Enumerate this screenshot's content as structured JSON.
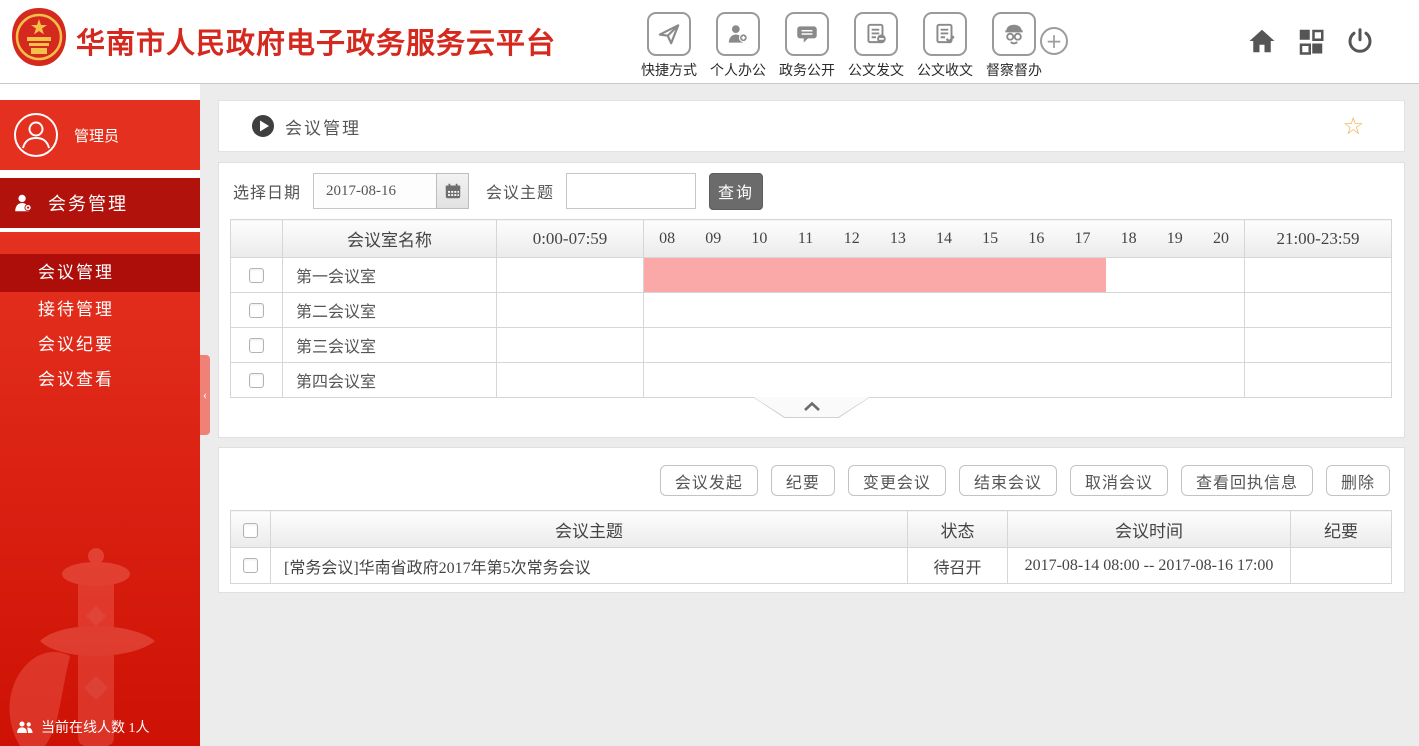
{
  "app": {
    "title": "华南市人民政府电子政务服务云平台"
  },
  "topbar": {
    "quick_items": [
      {
        "label": "快捷方式"
      },
      {
        "label": "个人办公"
      },
      {
        "label": "政务公开"
      },
      {
        "label": "公文发文"
      },
      {
        "label": "公文收文"
      },
      {
        "label": "督察督办"
      }
    ],
    "add_glyph": "+"
  },
  "sidebar": {
    "user_name": "管理员",
    "section_label": "会务管理",
    "menu": [
      {
        "label": "会议管理"
      },
      {
        "label": "接待管理"
      },
      {
        "label": "会议纪要"
      },
      {
        "label": "会议查看"
      }
    ],
    "collapse_glyph": "‹",
    "online_label": "当前在线人数 1人"
  },
  "page": {
    "title": "会议管理",
    "favorite_glyph": "☆"
  },
  "filter": {
    "date_label": "选择日期",
    "date_value": "2017-08-16",
    "topic_label": "会议主题",
    "topic_value": "",
    "search_button": "查询"
  },
  "schedule": {
    "room_header": "会议室名称",
    "early_header": "0:00-07:59",
    "hour_labels": [
      "08",
      "09",
      "10",
      "11",
      "12",
      "13",
      "14",
      "15",
      "16",
      "17",
      "18",
      "19",
      "20"
    ],
    "late_header": "21:00-23:59",
    "rows": [
      {
        "room": "第一会议室",
        "highlighted": true,
        "busy_range": "08:00-17:59"
      },
      {
        "room": "第二会议室"
      },
      {
        "room": "第三会议室"
      },
      {
        "room": "第四会议室"
      }
    ],
    "busy_color": "#fba8a8",
    "highlight_color": "#fdfbdc"
  },
  "actions": {
    "labels": [
      "会议发起",
      "纪要",
      "变更会议",
      "结束会议",
      "取消会议",
      "查看回执信息",
      "删除"
    ]
  },
  "meetings": {
    "headers": {
      "topic": "会议主题",
      "status": "状态",
      "time": "会议时间",
      "minutes": "纪要"
    },
    "rows": [
      {
        "topic": "[常务会议]华南省政府2017年第5次常务会议",
        "status": "待召开",
        "time": "2017-08-14 08:00 -- 2017-08-16 17:00",
        "minutes": ""
      }
    ]
  },
  "colors": {
    "brand_red": "#d5281e",
    "sidebar_red": "#e4311f",
    "sidebar_dark_red": "#b2120c",
    "active_item_red": "#ae0e09",
    "star_accent": "#f2b14e",
    "busy_pink": "#fba8a8",
    "row_yellow": "#fdfbdc",
    "search_button_gray": "#6b6b6b"
  }
}
